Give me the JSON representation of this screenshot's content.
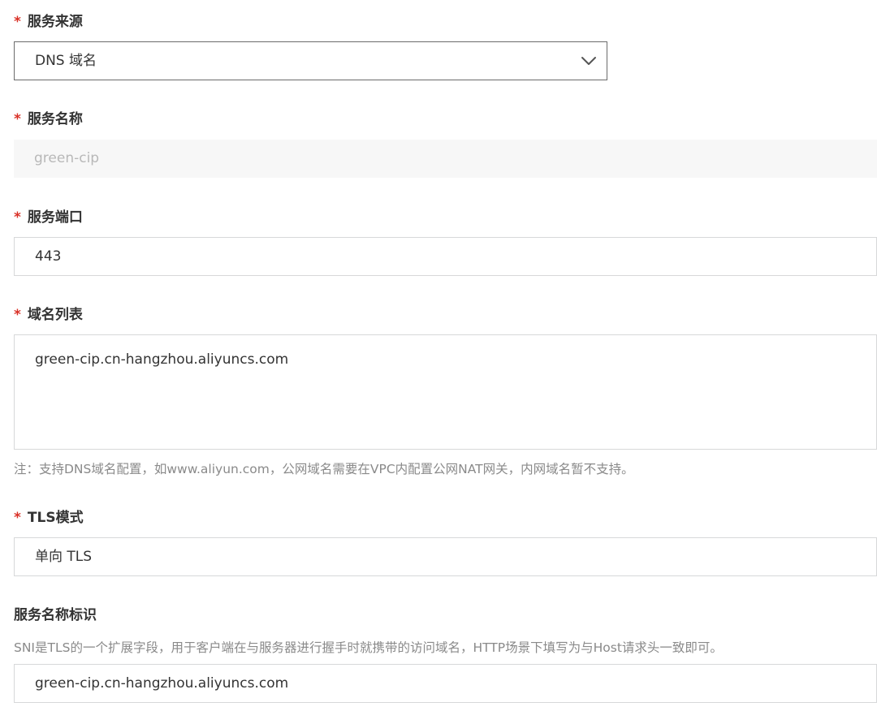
{
  "form": {
    "required_mark": "*",
    "service_source": {
      "label": "服务来源",
      "value": "DNS 域名",
      "icon": "chevron-down-icon"
    },
    "service_name": {
      "label": "服务名称",
      "placeholder": "green-cip"
    },
    "service_port": {
      "label": "服务端口",
      "value": "443"
    },
    "domain_list": {
      "label": "域名列表",
      "value": "green-cip.cn-hangzhou.aliyuncs.com",
      "note": "注：支持DNS域名配置，如www.aliyun.com，公网域名需要在VPC内配置公网NAT网关，内网域名暂不支持。"
    },
    "tls_mode": {
      "label": "TLS模式",
      "value": "单向 TLS"
    },
    "sni": {
      "label": "服务名称标识",
      "description": "SNI是TLS的一个扩展字段，用于客户端在与服务器进行握手时就携带的访问域名，HTTP场景下填写为与Host请求头一致即可。",
      "value": "green-cip.cn-hangzhou.aliyuncs.com"
    }
  }
}
